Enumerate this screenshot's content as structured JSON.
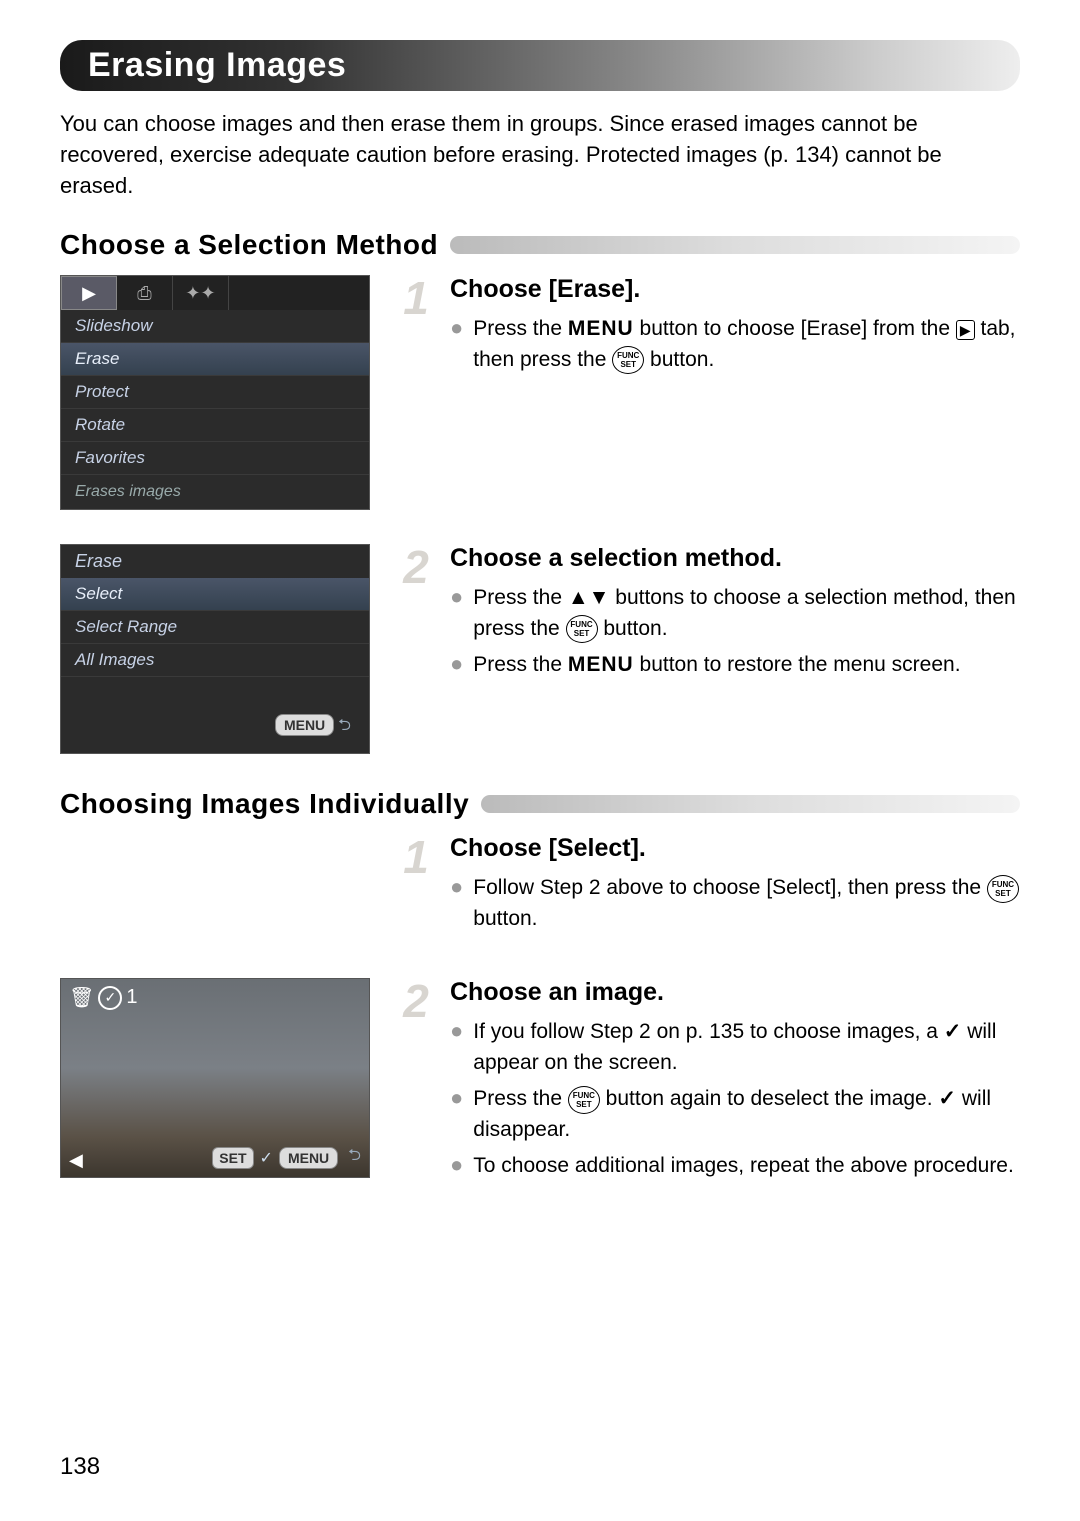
{
  "page_number": "138",
  "title": "Erasing Images",
  "intro": "You can choose images and then erase them in groups. Since erased images cannot be recovered, exercise adequate caution before erasing. Protected images (p. 134) cannot be erased.",
  "section1": {
    "heading": "Choose a Selection Method",
    "menu_screenshot": {
      "tabs": {
        "play": "▶",
        "print": "⎙",
        "tools": "✦✦"
      },
      "items": [
        "Slideshow",
        "Erase",
        "Protect",
        "Rotate",
        "Favorites"
      ],
      "selected": "Erase",
      "description": "Erases images"
    },
    "erase_screenshot": {
      "title": "Erase",
      "items": [
        "Select",
        "Select Range",
        "All Images"
      ],
      "selected": "Select",
      "footer": "MENU"
    },
    "step1": {
      "num": "1",
      "title": "Choose [Erase].",
      "b1a": "Press the ",
      "b1_menu": "MENU",
      "b1b": " button to choose [Erase] from the ",
      "b1c": " tab, then press the ",
      "b1d": " button.",
      "func_top": "FUNC",
      "func_bot": "SET",
      "play_icon": "▶"
    },
    "step2": {
      "num": "2",
      "title": "Choose a selection method.",
      "b1a": "Press the ",
      "b1b": " buttons to choose a selection method, then press the ",
      "b1c": " button.",
      "b2a": "Press the ",
      "b2_menu": "MENU",
      "b2b": " button to restore the menu screen."
    }
  },
  "section2": {
    "heading": "Choosing Images Individually",
    "step1": {
      "num": "1",
      "title": "Choose [Select].",
      "b1a": "Follow Step 2 above to choose [Select], then press the ",
      "b1b": " button."
    },
    "step2": {
      "num": "2",
      "title": "Choose an image.",
      "b1a": "If you follow Step 2 on p. 135 to choose images, a ",
      "b1b": " will appear on the screen.",
      "b2a": "Press the ",
      "b2b": " button again to deselect the image. ",
      "b2c": " will disappear.",
      "b3": "To choose additional images, repeat the above procedure."
    },
    "image_screenshot": {
      "counter": "1",
      "set": "SET",
      "menu": "MENU",
      "check": "✓",
      "bl": "◀"
    }
  }
}
